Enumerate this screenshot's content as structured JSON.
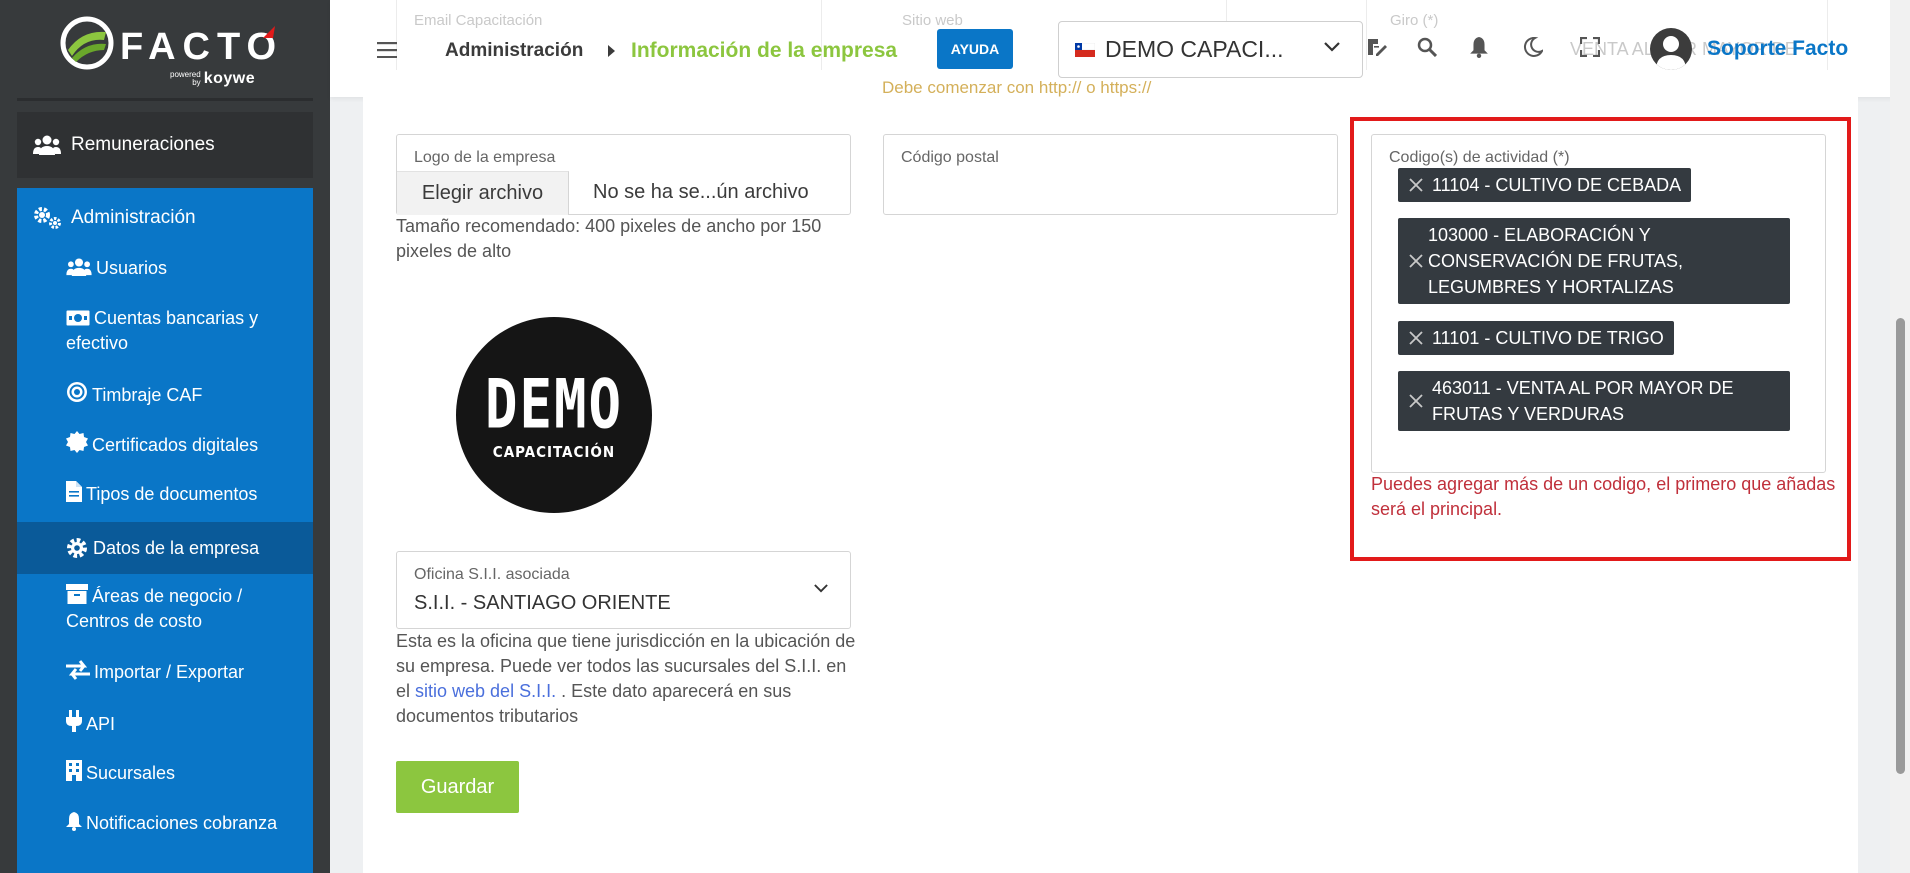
{
  "sidebar": {
    "logo": {
      "word": "FACTO",
      "powered": "powered",
      "by": "by",
      "brand": "koywe"
    },
    "remuneraciones": "Remuneraciones",
    "admin_label": "Administración",
    "items": [
      {
        "label": "Usuarios",
        "icon": "users-icon"
      },
      {
        "label": "Cuentas bancarias y efectivo",
        "icon": "money-icon"
      },
      {
        "label": "Timbraje CAF",
        "icon": "target-icon"
      },
      {
        "label": "Certificados digitales",
        "icon": "certificate-icon"
      },
      {
        "label": "Tipos de documentos",
        "icon": "document-icon"
      },
      {
        "label": "Datos de la empresa",
        "icon": "gear-icon",
        "active": true
      },
      {
        "label": "Áreas de negocio / Centros de costo",
        "icon": "archive-icon"
      },
      {
        "label": "Importar / Exportar",
        "icon": "exchange-icon"
      },
      {
        "label": "API",
        "icon": "plug-icon"
      },
      {
        "label": "Sucursales",
        "icon": "building-icon"
      },
      {
        "label": "Notificaciones cobranza",
        "icon": "bell-icon"
      }
    ]
  },
  "header": {
    "breadcrumb_root": "Administración",
    "breadcrumb_current": "Información de la empresa",
    "help_label": "AYUDA",
    "company": "DEMO CAPACI...",
    "user": "Soporte Facto",
    "ghost": {
      "label_email": "Email Capacitación",
      "label_web": "Sitio web",
      "label_giro": "Giro (*)",
      "value_giro": "VENTA AL POR MAYOR DE",
      "link_text": "Debe comenzar con http:// o https://"
    }
  },
  "form": {
    "logo_label": "Logo de la empresa",
    "file_button": "Elegir archivo",
    "file_name": "No se ha se...ún archivo",
    "logo_help": "Tamaño recomendado: 400 pixeles de ancho por 150 pixeles de alto",
    "demo_logo_big": "DEMO",
    "demo_logo_small": "CAPACITACIÓN",
    "postal_label": "Código postal",
    "activity_label": "Codigo(s) de actividad (*)",
    "activity_tags": [
      "11104 - CULTIVO DE CEBADA",
      "103000 - ELABORACIÓN Y CONSERVACIÓN DE FRUTAS, LEGUMBRES Y HORTALIZAS",
      "11101 - CULTIVO DE TRIGO",
      "463011 - VENTA AL POR MAYOR DE FRUTAS Y VERDURAS"
    ],
    "activity_help": "Puedes agregar más de un codigo, el primero que añadas será el principal.",
    "sii_label": "Oficina S.I.I. asociada",
    "sii_value": "S.I.I. - SANTIAGO ORIENTE",
    "sii_help_before": "Esta es la oficina que tiene jurisdicción en la ubicación de su empresa. Puede ver todos las sucursales del S.I.I. en el ",
    "sii_help_link": "sitio web del S.I.I.",
    "sii_help_after": " . Este dato aparecerá en sus documentos tributarios",
    "save_label": "Guardar"
  },
  "colors": {
    "sidebar_bg": "#373a3c",
    "admin_blue": "#0a76c7",
    "active_blue": "#0a5a99",
    "green": "#8cc63f",
    "tag_bg": "#343a40",
    "warn_red": "#c0303b",
    "highlight_red": "#e21a1a"
  }
}
